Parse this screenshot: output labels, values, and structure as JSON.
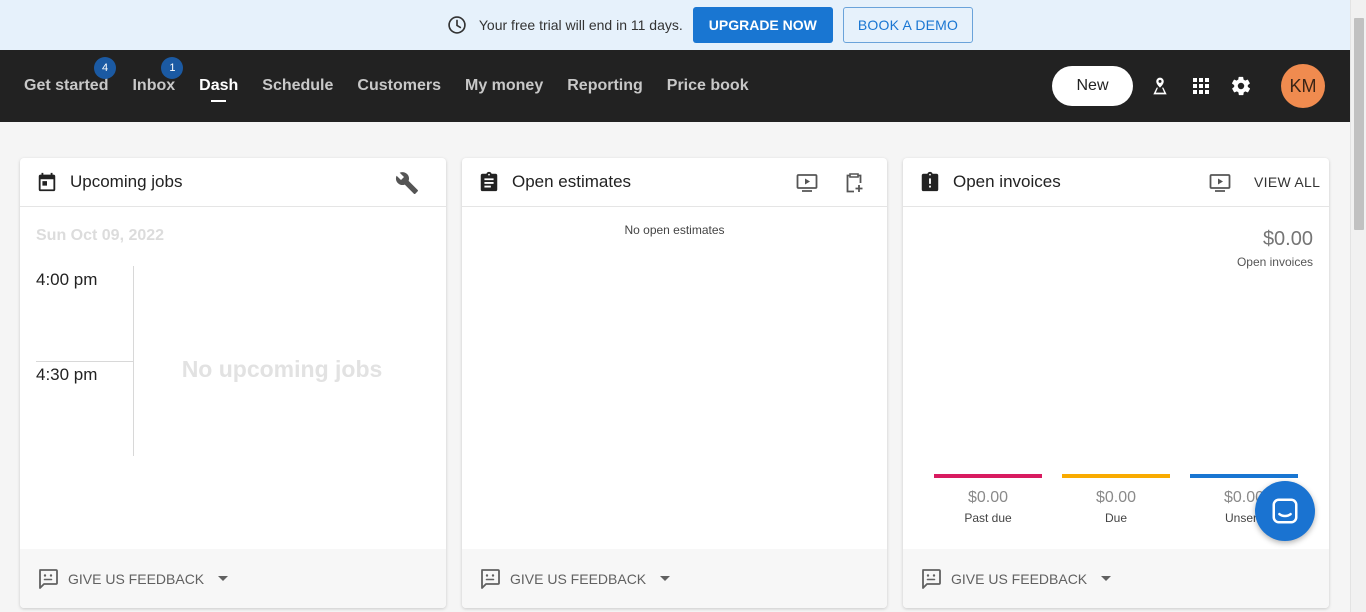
{
  "banner": {
    "message": "Your free trial will end in 11 days.",
    "upgrade_label": "UPGRADE NOW",
    "demo_label": "BOOK A DEMO"
  },
  "nav": {
    "items": [
      {
        "label": "Get started",
        "badge": "4"
      },
      {
        "label": "Inbox",
        "badge": "1"
      },
      {
        "label": "Dash"
      },
      {
        "label": "Schedule"
      },
      {
        "label": "Customers"
      },
      {
        "label": "My money"
      },
      {
        "label": "Reporting"
      },
      {
        "label": "Price book"
      }
    ],
    "active": "Dash",
    "new_label": "New",
    "icons": [
      "map-pin-icon",
      "apps-grid-icon",
      "gear-icon"
    ],
    "avatar_initials": "KM"
  },
  "cards": {
    "upcoming_jobs": {
      "title": "Upcoming jobs",
      "date": "Sun Oct 09, 2022",
      "times": [
        "4:00 pm",
        "4:30 pm"
      ],
      "empty_text": "No upcoming jobs"
    },
    "open_estimates": {
      "title": "Open estimates",
      "empty_text": "No open estimates"
    },
    "open_invoices": {
      "title": "Open invoices",
      "view_all_label": "VIEW ALL",
      "total_amount": "$0.00",
      "total_label": "Open invoices",
      "breakdown": [
        {
          "amount": "$0.00",
          "label": "Past due",
          "color": "#d81b60"
        },
        {
          "amount": "$0.00",
          "label": "Due",
          "color": "#f9ab00"
        },
        {
          "amount": "$0.00",
          "label": "Unsent",
          "color": "#1976d2"
        }
      ]
    }
  },
  "feedback_label": "GIVE US FEEDBACK",
  "colors": {
    "accent": "#1976d2",
    "nav_bg": "#222222",
    "banner_bg": "#e6f1fb",
    "avatar": "#f08b4f"
  }
}
